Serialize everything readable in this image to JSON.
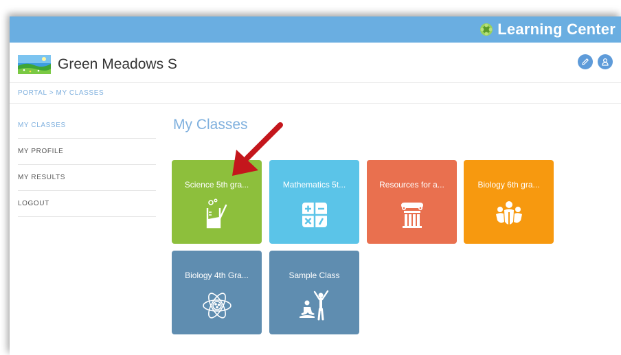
{
  "brand": {
    "title": "Learning Center"
  },
  "header": {
    "school_name": "Green Meadows S",
    "buttons": [
      {
        "name": "edit-button",
        "icon": "pencil-icon"
      },
      {
        "name": "profile-button",
        "icon": "user-icon"
      }
    ]
  },
  "breadcrumb": {
    "text": "PORTAL > MY CLASSES"
  },
  "sidebar": {
    "items": [
      {
        "label": "MY CLASSES",
        "active": true
      },
      {
        "label": "MY PROFILE",
        "active": false
      },
      {
        "label": "MY RESULTS",
        "active": false
      },
      {
        "label": "LOGOUT",
        "active": false
      }
    ]
  },
  "main": {
    "title": "My Classes",
    "classes": [
      {
        "label": "Science 5th gra...",
        "color": "#8dbf3c",
        "icon": "beaker-icon"
      },
      {
        "label": "Mathematics 5t...",
        "color": "#5bc4e8",
        "icon": "math-operators-icon"
      },
      {
        "label": "Resources for a...",
        "color": "#e9704f",
        "icon": "column-icon"
      },
      {
        "label": "Biology 6th gra...",
        "color": "#f7990f",
        "icon": "people-group-icon"
      },
      {
        "label": "Biology 4th Gra...",
        "color": "#5f8db0",
        "icon": "atom-icon"
      },
      {
        "label": "Sample Class",
        "color": "#5f8db0",
        "icon": "yoga-people-icon"
      }
    ]
  },
  "colors": {
    "topbar": "#6aaee1",
    "accent": "#7fb0de",
    "arrow": "#c4161c"
  }
}
